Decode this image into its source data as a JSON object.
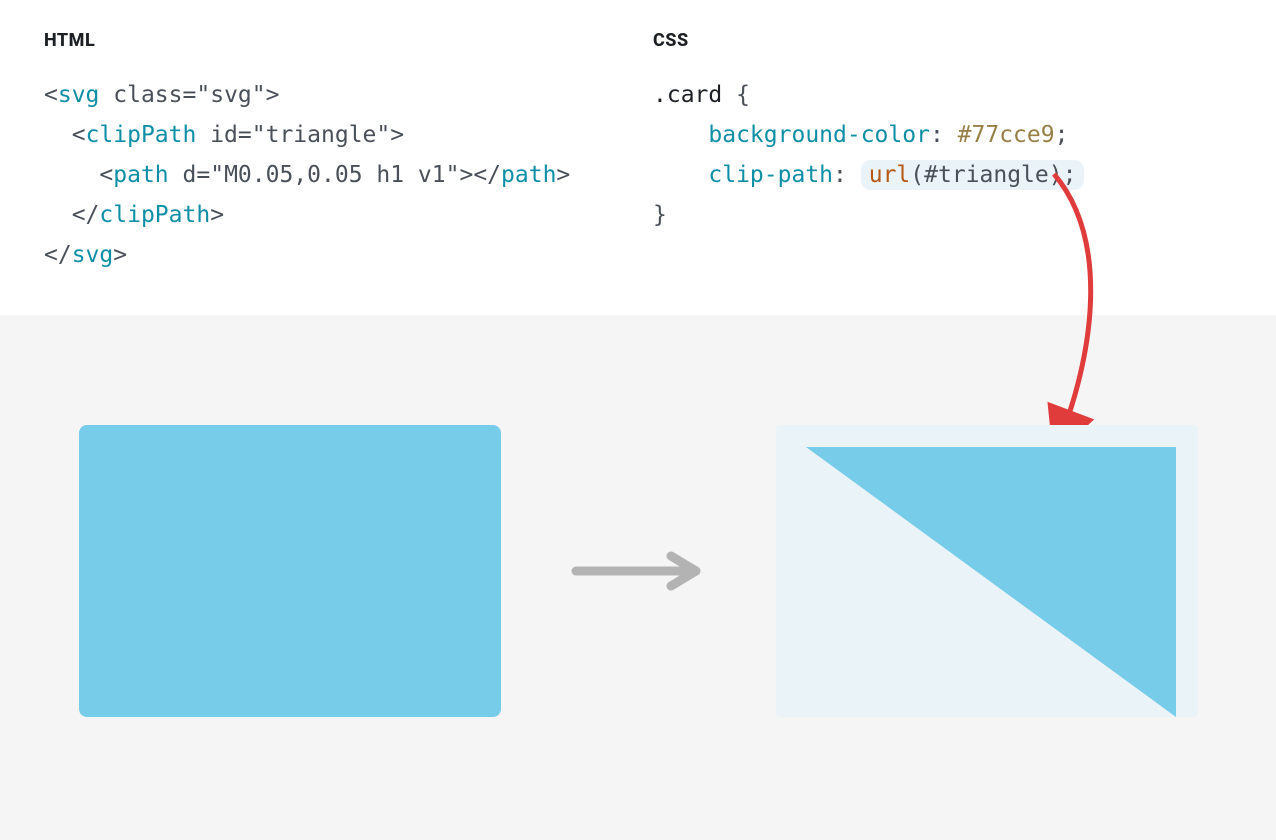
{
  "labels": {
    "html": "HTML",
    "css": "CSS"
  },
  "html_code": {
    "line1_lt": "<",
    "line1_tag": "svg",
    "line1_sp": " ",
    "line1_attr": "class",
    "line1_eq": "=",
    "line1_val": "\"svg\"",
    "line1_gt": ">",
    "line2_indent": "  ",
    "line2_lt": "<",
    "line2_tag": "clipPath",
    "line2_sp": " ",
    "line2_attr": "id",
    "line2_eq": "=",
    "line2_val": "\"triangle\"",
    "line2_gt": ">",
    "line3_indent": "    ",
    "line3_lt": "<",
    "line3_tag": "path",
    "line3_sp": " ",
    "line3_attr": "d",
    "line3_eq": "=",
    "line3_val": "\"M0.05,0.05 h1 v1\"",
    "line3_gt": ">",
    "line3_close_lt": "</",
    "line3_close_tag": "path",
    "line3_close_gt": ">",
    "line4_indent": "  ",
    "line4_lt": "</",
    "line4_tag": "clipPath",
    "line4_gt": ">",
    "line5_lt": "</",
    "line5_tag": "svg",
    "line5_gt": ">"
  },
  "css_code": {
    "selector": ".card",
    "brace_open": " {",
    "indent": "    ",
    "prop1": "background-color",
    "colon": ": ",
    "val1": "#77cce9",
    "semi": ";",
    "prop2": "clip-path",
    "func": "url",
    "paren_open": "(",
    "func_arg": "#triangle",
    "paren_close": ")",
    "brace_close": "}"
  },
  "colors": {
    "card_bg": "#77cce9",
    "result_frame": "#eaf3f8",
    "arrow_red": "#e03c3c",
    "arrow_gray": "#b3b3b3"
  }
}
